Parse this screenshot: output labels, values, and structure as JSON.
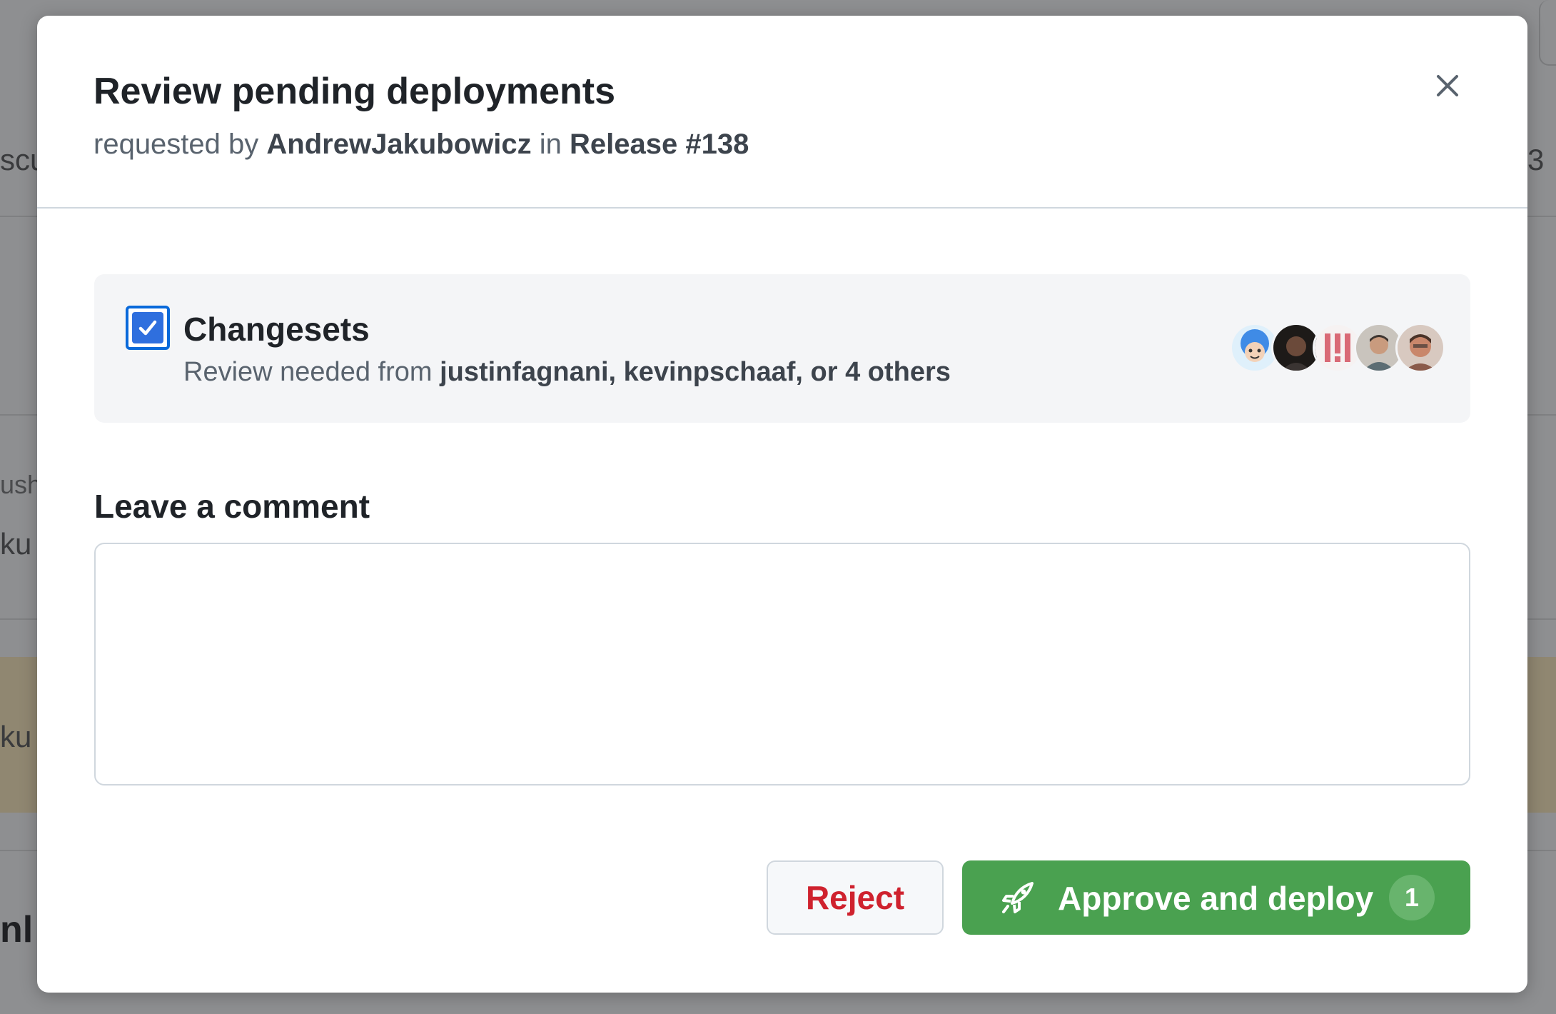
{
  "background": {
    "fragments": [
      "scu",
      "ush",
      "ku",
      "ku",
      "nl",
      "3"
    ]
  },
  "dialog": {
    "title": "Review pending deployments",
    "subtitle": {
      "prefix": "requested by",
      "user": "AndrewJakubowicz",
      "middle": "in",
      "run": "Release #138"
    },
    "close_icon": "close-icon"
  },
  "environment": {
    "checked": true,
    "name": "Changesets",
    "review": {
      "prefix": "Review needed from",
      "reviewers": "justinfagnani, kevinpschaaf,",
      "suffix": "or 4 others"
    },
    "avatars": [
      {
        "name": "avatar-1",
        "color": "#3f8be6"
      },
      {
        "name": "avatar-2",
        "color": "#2a2522"
      },
      {
        "name": "avatar-3",
        "color": "#e6a0a6"
      },
      {
        "name": "avatar-4",
        "color": "#9a8f84"
      },
      {
        "name": "avatar-5",
        "color": "#c48a74"
      }
    ]
  },
  "comment": {
    "label": "Leave a comment",
    "value": "",
    "placeholder": ""
  },
  "actions": {
    "reject_label": "Reject",
    "approve_label": "Approve and deploy",
    "approve_count": "1",
    "approve_icon": "rocket-icon"
  },
  "colors": {
    "approve": "#4aa150",
    "reject_text": "#cf222e",
    "checkbox": "#2f6fde"
  }
}
